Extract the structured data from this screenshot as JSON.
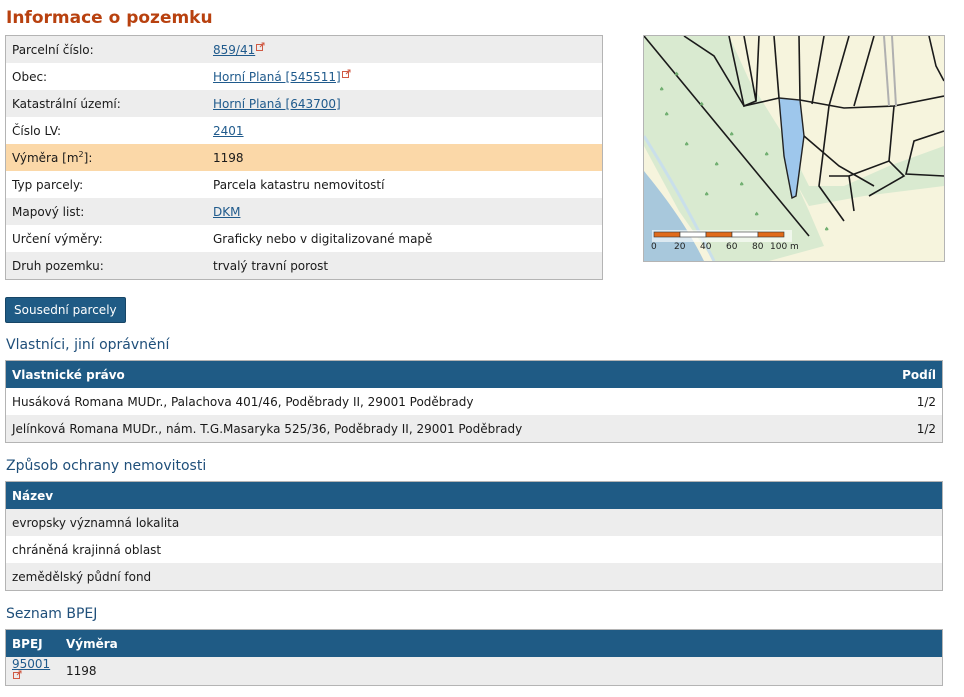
{
  "page_title": "Informace o pozemku",
  "info": {
    "parcel_no": {
      "label": "Parcelní číslo:",
      "value": "859/41"
    },
    "obec": {
      "label": "Obec:",
      "value": "Horní Planá [545511]"
    },
    "ku": {
      "label": "Katastrální území:",
      "value": "Horní Planá [643700]"
    },
    "lv": {
      "label": "Číslo LV:",
      "value": "2401"
    },
    "vymera": {
      "label_main": "Výměra [m",
      "label_sup": "2",
      "label_end": "]:",
      "value": "1198"
    },
    "typ": {
      "label": "Typ parcely:",
      "value": "Parcela katastru nemovitostí"
    },
    "mapovy_list": {
      "label": "Mapový list:",
      "value": "DKM"
    },
    "urceni": {
      "label": "Určení výměry:",
      "value": "Graficky nebo v digitalizované mapě"
    },
    "druh": {
      "label": "Druh pozemku:",
      "value": "trvalý travní porost"
    }
  },
  "map": {
    "scale_labels": [
      "0",
      "20",
      "40",
      "60",
      "80",
      "100 m"
    ],
    "colors": {
      "land": "#f6f4dd",
      "forest": "#d9ead0",
      "water": "#a8c8dc",
      "parcel": "#9ec7ec",
      "scale_orange": "#e06a1a"
    }
  },
  "neighbours_button": "Sousední parcely",
  "owners": {
    "title": "Vlastníci, jiní oprávnění",
    "col_name": "Vlastnické právo",
    "col_share": "Podíl",
    "rows": [
      {
        "name": "Husáková Romana MUDr., Palachova 401/46, Poděbrady II, 29001 Poděbrady",
        "share": "1/2"
      },
      {
        "name": "Jelínková Romana MUDr., nám. T.G.Masaryka 525/36, Poděbrady II, 29001 Poděbrady",
        "share": "1/2"
      }
    ]
  },
  "protection": {
    "title": "Způsob ochrany nemovitosti",
    "col_name": "Název",
    "rows": [
      "evropsky významná lokalita",
      "chráněná krajinná oblast",
      "zemědělský půdní fond"
    ]
  },
  "bpej": {
    "title": "Seznam BPEJ",
    "col_code": "BPEJ",
    "col_area": "Výměra",
    "rows": [
      {
        "code": "95001",
        "area": "1198"
      }
    ]
  }
}
